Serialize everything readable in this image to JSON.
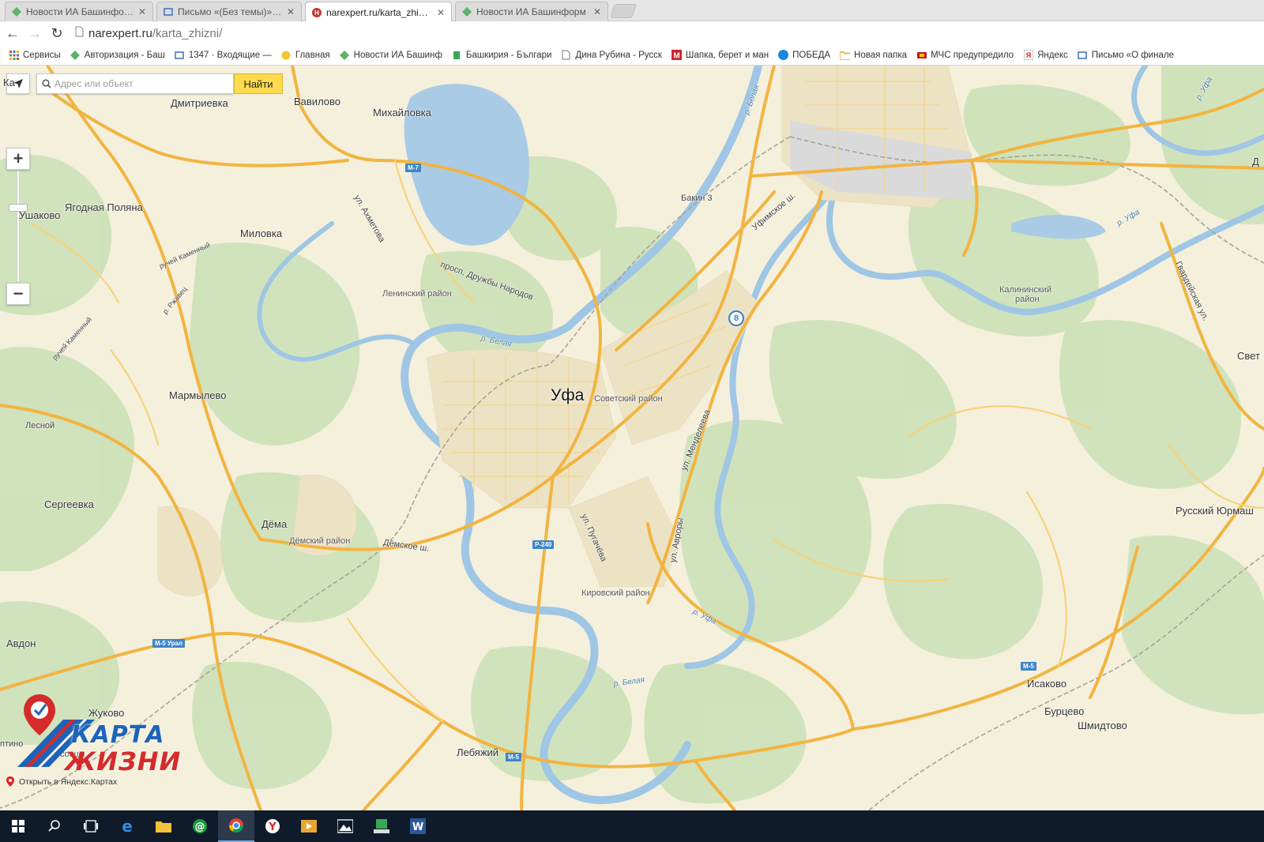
{
  "browser": {
    "tabs": [
      {
        "title": "Новости ИА Башинформ",
        "favicon": "bashinform-icon",
        "active": false
      },
      {
        "title": "Письмо «(Без темы)» — ",
        "favicon": "mail-icon",
        "active": false
      },
      {
        "title": "narexpert.ru/karta_zhizni/",
        "favicon": "narexpert-icon",
        "active": true
      },
      {
        "title": "Новости ИА Башинформ",
        "favicon": "bashinform-icon",
        "active": false
      }
    ],
    "url_host": "narexpert.ru",
    "url_path": "/karta_zhizni/",
    "bookmarks": [
      {
        "label": "Сервисы",
        "icon": "apps-grid-icon"
      },
      {
        "label": "Авторизация - Баш",
        "icon": "bashinform-icon"
      },
      {
        "label": "1347 · Входящие — ",
        "icon": "mail-icon"
      },
      {
        "label": "Главная",
        "icon": "smiley-icon"
      },
      {
        "label": "Новости ИА Башинф",
        "icon": "bashinform-icon"
      },
      {
        "label": "Башкирия - Българи",
        "icon": "flag-icon"
      },
      {
        "label": "Дина Рубина - Русск",
        "icon": "page-icon"
      },
      {
        "label": "Шапка, берет и ман",
        "icon": "m-red-icon"
      },
      {
        "label": "ПОБЕДА",
        "icon": "blue-circle-icon"
      },
      {
        "label": "Новая папка",
        "icon": "folder-icon"
      },
      {
        "label": "МЧС предупредило",
        "icon": "mchs-icon"
      },
      {
        "label": "Яндекс",
        "icon": "yandex-icon"
      },
      {
        "label": "Письмо «О финале ",
        "icon": "mail-icon"
      }
    ]
  },
  "map": {
    "search_placeholder": "Адрес или объект",
    "search_value": "",
    "find_label": "Найти",
    "zoom_in": "+",
    "zoom_out": "−",
    "open_in_yandex": "Открыть в Яндекс.Картах",
    "route_badge": "8",
    "logo_line1": "КАРТА",
    "logo_line2": "ЖИЗНИ",
    "city": "Уфа",
    "places": {
      "dmitrievka": "Дмитриевка",
      "vavilovo": "Вавилово",
      "mikhailovka": "Михайловка",
      "ushakovo": "Ушаково",
      "yagodnaya": "Ягодная Поляна",
      "milovka": "Миловка",
      "marmylevo": "Мармылево",
      "lesnoy": "Лесной",
      "sergeevka": "Сергеевка",
      "dema": "Дёма",
      "avdon": "Авдон",
      "zhukovo": "Жуково",
      "lebyazhiy": "Лебяжий",
      "bakin3": "Бакин 3",
      "isakovo": "Исаково",
      "burtsevo": "Бурцево",
      "shmidtovo": "Шмидтово",
      "russkiy_yurmash": "Русский Юрмаш",
      "sveta": "Свет",
      "ka_edge": "Ка",
      "d_edge": "Д",
      "ptino": "птино",
      "sovtsy": "совцы"
    },
    "districts": {
      "leninsky": "Ленинский район",
      "sovetsky": "Советский район",
      "demsky": "Дёмский район",
      "kirovsky": "Кировский район",
      "kalininsky_1": "Калининский",
      "kalininsky_2": "район"
    },
    "streets": {
      "akhmetova": "ул. Ахметова",
      "druzhby": "просп. Дружбы Народов",
      "ufimskoe": "Уфимское ш.",
      "mendeleeva": "ул. Менделеева",
      "demskoe": "Дёмское ш.",
      "pugacheva": "ул. Пугачёва",
      "avrory": "ул. Авроры",
      "gvardeyskaya": "Гвардейская ул.",
      "ruchey_kamenny": "ручей Каменный",
      "ruchey_kamenny2": "ручей Каменный",
      "r_rzhavets": "р. Ржавец"
    },
    "rivers": {
      "belaya1": "р. Белая",
      "belaya2": "р. Белая",
      "belaya3": "р. Белая",
      "ufa1": "р. Уфа",
      "ufa2": "р. Уфа",
      "ufa3": "р. Уфа"
    },
    "shields": {
      "m7": "М-7",
      "p240": "Р-240",
      "m5ural": "М-5 Урал",
      "m5a": "М-5",
      "m5b": "М-5"
    }
  },
  "taskbar": {
    "items": [
      "windows-start-icon",
      "search-icon",
      "task-view-icon",
      "edge-icon",
      "file-explorer-icon",
      "mail-agent-icon",
      "chrome-icon",
      "yandex-browser-icon",
      "media-player-icon",
      "photos-icon",
      "app-green-icon",
      "word-icon"
    ],
    "active": "chrome-icon"
  }
}
